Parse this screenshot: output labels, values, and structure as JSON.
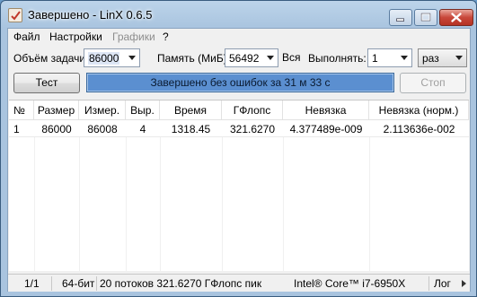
{
  "window": {
    "title": "Завершено - LinX 0.6.5"
  },
  "menu": [
    "Файл",
    "Настройки",
    "Графики",
    "?"
  ],
  "controls": {
    "problem_size_label": "Объём задачи:",
    "problem_size_value": "86000",
    "memory_label": "Память (МиБ):",
    "memory_value": "56492",
    "memory_all": "Вся",
    "run_label": "Выполнять:",
    "run_value": "1",
    "run_unit": "раз"
  },
  "buttons": {
    "test": "Тест",
    "stop": "Стоп"
  },
  "progress": {
    "text": "Завершено без ошибок за 31 м 33 с",
    "fraction": 1.0
  },
  "table": {
    "columns": [
      "№",
      "Размер",
      "Измер.",
      "Выр.",
      "Время",
      "ГФлопс",
      "Невязка",
      "Невязка (норм.)"
    ],
    "rows": [
      [
        "1",
        "86000",
        "86008",
        "4",
        "1318.45",
        "321.6270",
        "4.377489e-009",
        "2.113636e-002"
      ]
    ]
  },
  "statusbar": {
    "progress": "1/1",
    "bits": "64-бит",
    "threads_info": "20 потоков 321.6270 ГФлопс пик",
    "cpu": "Intel® Core™ i7-6950X",
    "log": "Лог"
  },
  "colors": {
    "progress_fill": "#5b8fd0",
    "close_button": "#c8473a",
    "disabled_text": "#8d8d8d"
  },
  "icons": [
    "app-icon",
    "minimize-icon",
    "maximize-icon",
    "close-icon",
    "dropdown-arrow-icon",
    "log-arrow-icon"
  ]
}
